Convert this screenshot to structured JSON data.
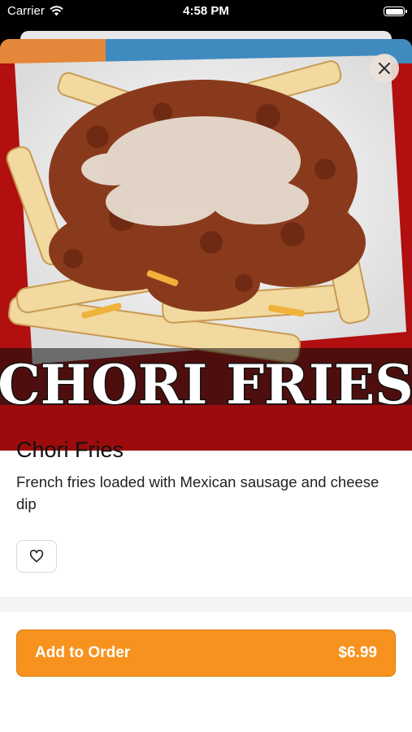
{
  "status_bar": {
    "carrier": "Carrier",
    "time": "4:58 PM"
  },
  "item": {
    "image_text": "CHORI FRIES",
    "title": "Chori Fries",
    "description": "French fries loaded with Mexican sausage and cheese dip"
  },
  "order": {
    "label": "Add to Order",
    "price": "$6.99"
  },
  "colors": {
    "accent": "#f7921e",
    "hero_red": "#b10f10"
  },
  "icons": {
    "close": "close-icon",
    "favorite": "heart-icon",
    "wifi": "wifi-icon",
    "battery": "battery-icon"
  }
}
